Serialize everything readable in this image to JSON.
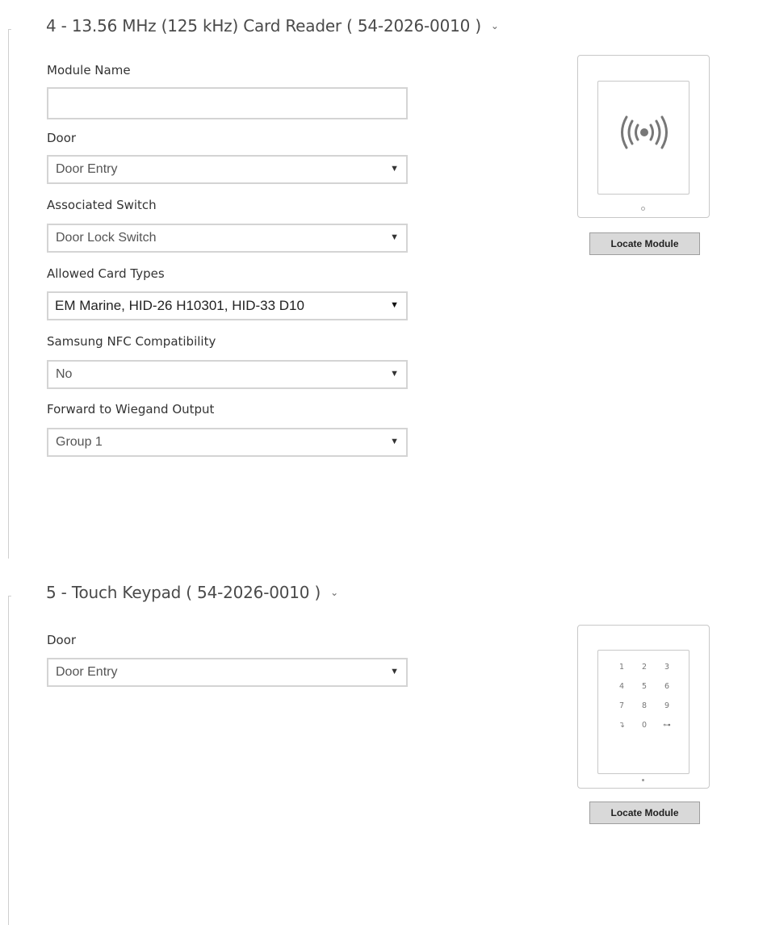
{
  "section4": {
    "title": "4 - 13.56 MHz (125 kHz) Card Reader ( 54-2026-0010 )",
    "chevron": "⌄",
    "module_name": {
      "label": "Module Name",
      "value": ""
    },
    "door": {
      "label": "Door",
      "value": "Door Entry"
    },
    "associated_switch": {
      "label": "Associated Switch",
      "value": "Door Lock Switch"
    },
    "allowed_card_types": {
      "label": "Allowed Card Types",
      "value": "EM Marine, HID-26 H10301, HID-33 D10"
    },
    "samsung_nfc": {
      "label": "Samsung NFC Compatibility",
      "value": "No"
    },
    "wiegand_output": {
      "label": "Forward to Wiegand Output",
      "value": "Group 1"
    },
    "device_icon": "rfid-reader-icon",
    "locate_label": "Locate Module"
  },
  "section5": {
    "title": "5 - Touch Keypad ( 54-2026-0010 )",
    "chevron": "⌄",
    "door": {
      "label": "Door",
      "value": "Door Entry"
    },
    "device_icon": "touch-keypad-icon",
    "keys": [
      "1",
      "2",
      "3",
      "4",
      "5",
      "6",
      "7",
      "8",
      "9",
      "↴",
      "0",
      "⊶"
    ],
    "locate_label": "Locate Module"
  },
  "colors": {
    "border": "#d4d4d4",
    "button_bg": "#d9d9d9",
    "text": "#333333"
  }
}
